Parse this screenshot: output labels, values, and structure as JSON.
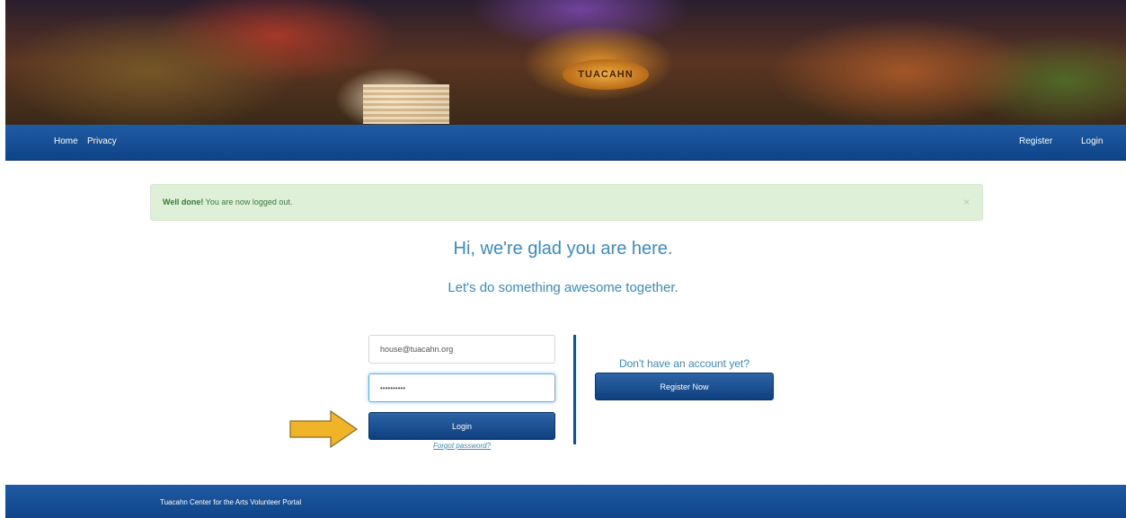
{
  "banner": {
    "sign_text": "TUACAHN"
  },
  "nav": {
    "left": [
      {
        "label": "Home"
      },
      {
        "label": "Privacy"
      }
    ],
    "right": [
      {
        "label": "Register"
      },
      {
        "label": "Login"
      }
    ]
  },
  "alert": {
    "strong": "Well done!",
    "message": " You are now logged out.",
    "close": "×"
  },
  "headline": {
    "title": "Hi, we're glad you are here.",
    "subtitle": "Let's do something awesome together."
  },
  "login": {
    "email_value": "house@tuacahn.org",
    "password_value": "••••••••••",
    "login_label": "Login",
    "forgot_label": "Forgot password?"
  },
  "register": {
    "prompt": "Don't have an account yet?",
    "button_label": "Register Now"
  },
  "footer": {
    "text": "Tuacahn Center for the Arts Volunteer Portal"
  },
  "colors": {
    "nav_blue": "#1f5ba3",
    "accent_blue": "#3a8cc4",
    "alert_green_bg": "#dff0d8",
    "arrow_yellow": "#f0b429"
  }
}
